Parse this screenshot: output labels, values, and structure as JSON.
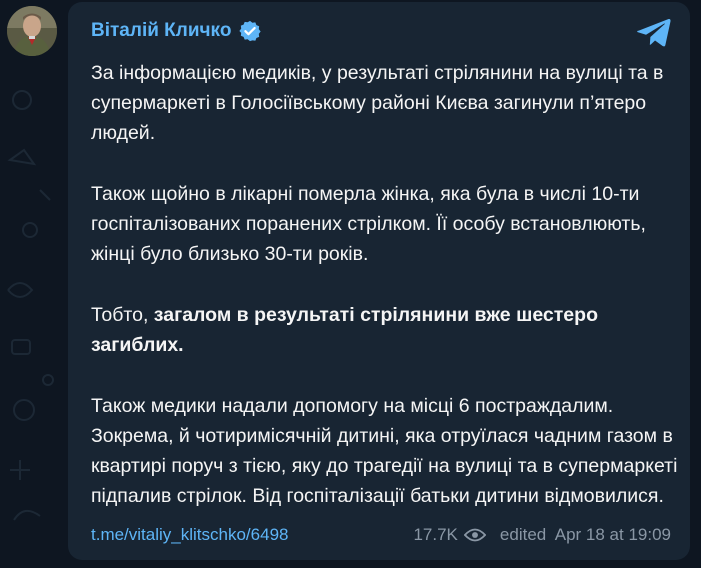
{
  "channel": {
    "name": "Віталій Кличко"
  },
  "message": {
    "p1": "За інформацією медиків, у результаті стрілянини на вулиці та в супермаркеті в Голосіївському районі Києва загинули п’ятеро людей.",
    "p2": "Також щойно в лікарні померла жінка, яка була в числі 10-ти госпіталізованих поранених стрілком. Її особу встановлюють, жінці було близько 30-ти років.",
    "p3_prefix": "Тобто, ",
    "p3_bold": "загалом в результаті стрілянини вже шестеро загиблих.",
    "p4": "Також медики надали допомогу на місці 6 постраждалим. Зокрема, й чотиримісячній дитині, яка отруїлася чадним газом в квартирі поруч з тією, яку до трагедії на вулиці та в супермаркеті підпалив стрілок. Від госпіталізації батьки дитини відмовилися."
  },
  "footer": {
    "link": "t.me/vitaliy_klitschko/6498",
    "views": "17.7K",
    "edited": "edited  Apr 18 at 19:09"
  },
  "icons": {
    "verified": "verified-badge-icon",
    "telegram": "telegram-logo-icon",
    "eye": "eye-icon"
  },
  "colors": {
    "background": "#0e1621",
    "bubble": "#182533",
    "accent": "#5eb5f7",
    "text": "#f5f5f5",
    "muted": "#8a97a5"
  }
}
